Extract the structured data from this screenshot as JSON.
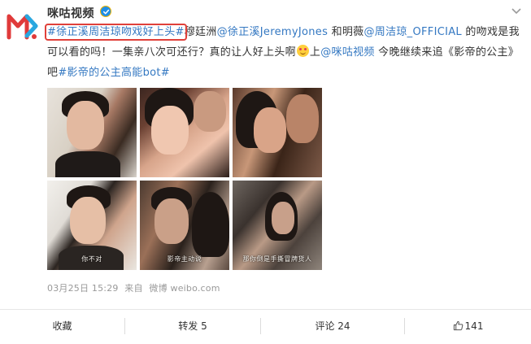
{
  "account": {
    "name": "咪咕视频",
    "verified": true
  },
  "post": {
    "segments": [
      {
        "type": "topic",
        "text": "#徐正溪周洁琼吻戏好上头#",
        "highlighted": true
      },
      {
        "type": "text",
        "text": "穆廷洲"
      },
      {
        "type": "mention",
        "text": "@徐正溪JeremyJones"
      },
      {
        "type": "text",
        "text": " 和明薇"
      },
      {
        "type": "mention",
        "text": "@周洁琼_OFFICIAL"
      },
      {
        "type": "text",
        "text": " 的吻戏是我可以看的吗！一集亲八次可还行？真的让人好上头啊"
      },
      {
        "type": "emoji",
        "text": ""
      },
      {
        "type": "text",
        "text": "上"
      },
      {
        "type": "mention",
        "text": "@咪咕视频"
      },
      {
        "type": "text",
        "text": " 今晚继续来追《影帝的公主》吧"
      },
      {
        "type": "topic",
        "text": "#影帝的公主高能bot#",
        "highlighted": false
      }
    ],
    "images": [
      {
        "caption": ""
      },
      {
        "caption": ""
      },
      {
        "caption": ""
      },
      {
        "caption": "你不对"
      },
      {
        "caption": "影帝主动说"
      },
      {
        "caption": "那你倒是手撕冒牌货人"
      }
    ],
    "meta": {
      "date": "03月25日 15:29",
      "source_prefix": "来自",
      "source": "微博 weibo.com"
    }
  },
  "actions": {
    "favorite": "收藏",
    "repost": "转发 5",
    "comment": "评论 24",
    "like_count": "141"
  },
  "colors": {
    "link": "#3478c2",
    "highlight_box": "#e0403a",
    "brand": "#e03a3a"
  },
  "icons": {
    "avatar": "migu-logo-icon",
    "verified": "verified-badge-icon",
    "more": "chevron-down-icon",
    "like": "thumbs-up-icon",
    "emoji": "smile-emoji-icon"
  }
}
